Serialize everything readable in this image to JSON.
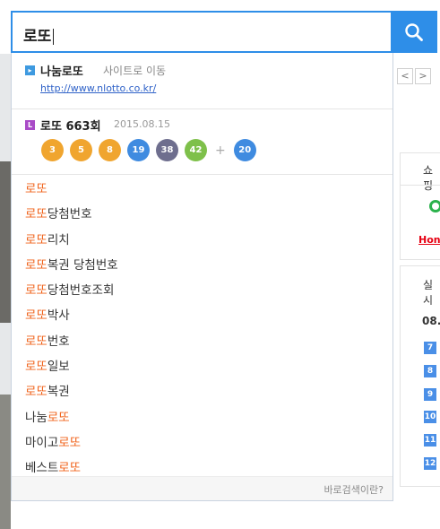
{
  "search": {
    "query": "로또"
  },
  "page": {
    "arrows": [
      "<",
      ">"
    ],
    "box1_label": "쇼핑",
    "box1_brand": "Hon",
    "box2_label": "실시",
    "box2_date": "08.",
    "ranks": [
      "7",
      "8",
      "9",
      "10",
      "11",
      "12"
    ]
  },
  "dropdown": {
    "site": {
      "name": "나눔로또",
      "action": "사이트로 이동",
      "url": "http://www.nlotto.co.kr/"
    },
    "lotto": {
      "title": "로또 663회",
      "date": "2015.08.15",
      "numbers": [
        "3",
        "5",
        "8",
        "19",
        "38",
        "42"
      ],
      "plus": "+",
      "bonus": "20",
      "colors": [
        "#f0a52f",
        "#f0a52f",
        "#f0a52f",
        "#3f8be0",
        "#6e6e8e",
        "#7ec04a",
        "#3f8be0"
      ]
    },
    "suggestions": [
      {
        "pre": "",
        "hl": "로또",
        "post": ""
      },
      {
        "pre": "",
        "hl": "로또",
        "post": "당첨번호"
      },
      {
        "pre": "",
        "hl": "로또",
        "post": "리치"
      },
      {
        "pre": "",
        "hl": "로또",
        "post": "복권 당첨번호"
      },
      {
        "pre": "",
        "hl": "로또",
        "post": "당첨번호조회"
      },
      {
        "pre": "",
        "hl": "로또",
        "post": "박사"
      },
      {
        "pre": "",
        "hl": "로또",
        "post": "번호"
      },
      {
        "pre": "",
        "hl": "로또",
        "post": "일보"
      },
      {
        "pre": "",
        "hl": "로또",
        "post": "복권"
      },
      {
        "pre": "나눔",
        "hl": "로또",
        "post": ""
      },
      {
        "pre": "마이고",
        "hl": "로또",
        "post": ""
      },
      {
        "pre": "베스트",
        "hl": "로또",
        "post": ""
      }
    ],
    "footer_link": "바로검색이란?"
  },
  "icons": {
    "search_button": "search-icon",
    "site_badge": "site-badge-icon",
    "lotto_badge": "lotto-badge-icon"
  },
  "colors": {
    "accent": "#2e8ee8",
    "highlight": "#f0631b",
    "link": "#2f62c8"
  }
}
